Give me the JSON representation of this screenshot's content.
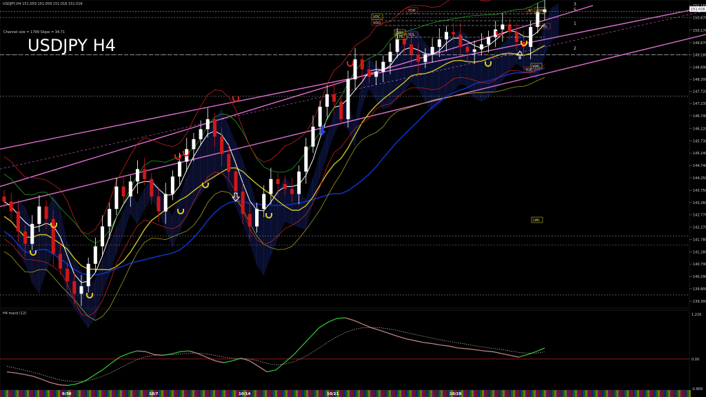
{
  "header": {
    "symbol_line": "USDJPY,H4 151.059 151.059 151.016 151.016",
    "title": "USDJPY H4",
    "channel_info": "Channel size = 1799 Slope = 34.71"
  },
  "right_axis": {
    "price_ticks": [
      "151.160",
      "151.016",
      "150.670",
      "150.170",
      "149.670",
      "149.180",
      "148.690",
      "148.200",
      "147.720",
      "147.230",
      "146.740",
      "146.220",
      "145.730",
      "145.240",
      "144.740",
      "144.250",
      "143.750",
      "143.260",
      "142.770",
      "142.270",
      "141.780",
      "141.280",
      "140.790",
      "140.290",
      "139.800",
      "139.300"
    ],
    "current_price": "151.016",
    "macd_ticks": [
      "1.216",
      "0.00",
      "-0.809"
    ]
  },
  "bottom_axis": {
    "date_labels": [
      "9/30",
      "10/7",
      "10/14",
      "10/21",
      "10/28"
    ]
  },
  "level_tags": [
    "YDH",
    "VDC",
    "VDO",
    "LWH",
    "YDL",
    "LML",
    "YDC",
    "VWL",
    "W",
    "VDH",
    "VDL",
    "LWL"
  ],
  "channel_numbers": [
    "3",
    "5",
    "1",
    "2"
  ],
  "macd_panel": {
    "title": "H4 macd (12)"
  },
  "chart_data": {
    "type": "candlestick",
    "title": "USDJPY H4",
    "symbol": "USDJPY",
    "timeframe": "H4",
    "x_labels": [
      "9/30",
      "10/7",
      "10/14",
      "10/21",
      "10/28"
    ],
    "ylim": [
      139.3,
      151.16
    ],
    "last": 151.016,
    "closes": [
      143.3,
      142.9,
      142.1,
      141.6,
      142.4,
      143.1,
      142.6,
      141.2,
      140.6,
      140.1,
      139.6,
      139.9,
      140.8,
      141.5,
      142.3,
      143.0,
      143.9,
      143.5,
      144.1,
      144.6,
      144.2,
      143.5,
      142.9,
      143.6,
      144.3,
      144.9,
      145.4,
      145.8,
      146.2,
      146.6,
      145.9,
      145.2,
      144.5,
      143.7,
      142.8,
      142.3,
      143.0,
      143.6,
      144.2,
      144.0,
      143.8,
      143.6,
      144.5,
      145.5,
      146.3,
      147.1,
      147.6,
      147.3,
      146.6,
      148.2,
      149.0,
      148.6,
      148.3,
      148.5,
      148.9,
      149.3,
      149.8,
      149.6,
      149.2,
      148.9,
      149.2,
      149.5,
      149.8,
      150.1,
      150.0,
      149.5,
      149.3,
      149.4,
      149.6,
      149.9,
      150.2,
      150.4,
      150.1,
      149.7,
      149.5,
      150.3,
      150.9,
      151.0
    ],
    "macd_ylim": [
      -0.809,
      1.216
    ],
    "macd_values": [
      -0.35,
      -0.38,
      -0.42,
      -0.47,
      -0.55,
      -0.64,
      -0.7,
      -0.72,
      -0.68,
      -0.6,
      -0.45,
      -0.3,
      -0.12,
      0.05,
      0.15,
      0.22,
      0.2,
      0.12,
      0.1,
      0.14,
      0.2,
      0.22,
      0.15,
      0.05,
      -0.05,
      -0.1,
      -0.05,
      0.02,
      -0.05,
      -0.2,
      -0.35,
      -0.3,
      -0.1,
      0.1,
      0.35,
      0.6,
      0.85,
      1.0,
      1.1,
      1.12,
      1.05,
      0.95,
      0.85,
      0.78,
      0.7,
      0.62,
      0.55,
      0.5,
      0.45,
      0.42,
      0.38,
      0.35,
      0.3,
      0.28,
      0.25,
      0.22,
      0.2,
      0.15,
      0.1,
      0.05,
      0.12,
      0.2,
      0.3
    ],
    "signal_values": [
      -0.2,
      -0.25,
      -0.3,
      -0.36,
      -0.42,
      -0.5,
      -0.56,
      -0.6,
      -0.61,
      -0.6,
      -0.55,
      -0.47,
      -0.37,
      -0.25,
      -0.13,
      -0.02,
      0.06,
      0.1,
      0.11,
      0.12,
      0.14,
      0.16,
      0.16,
      0.14,
      0.1,
      0.05,
      0.02,
      0.01,
      0.0,
      -0.05,
      -0.12,
      -0.16,
      -0.14,
      -0.08,
      0.02,
      0.15,
      0.3,
      0.46,
      0.6,
      0.72,
      0.8,
      0.85,
      0.86,
      0.85,
      0.82,
      0.78,
      0.72,
      0.67,
      0.62,
      0.57,
      0.52,
      0.48,
      0.44,
      0.4,
      0.36,
      0.32,
      0.29,
      0.26,
      0.22,
      0.18,
      0.16,
      0.16,
      0.19
    ]
  },
  "colors": {
    "background": "#000000",
    "bull_candle": "#ffffff",
    "bear_candle": "#d01818",
    "channel": "#e070d0",
    "macd_line": "#30c030",
    "macd_neg": "#c08080",
    "signal": "#c0c0c0",
    "ma_slow": "#1030c0",
    "ma_mid": "#d0c020"
  }
}
